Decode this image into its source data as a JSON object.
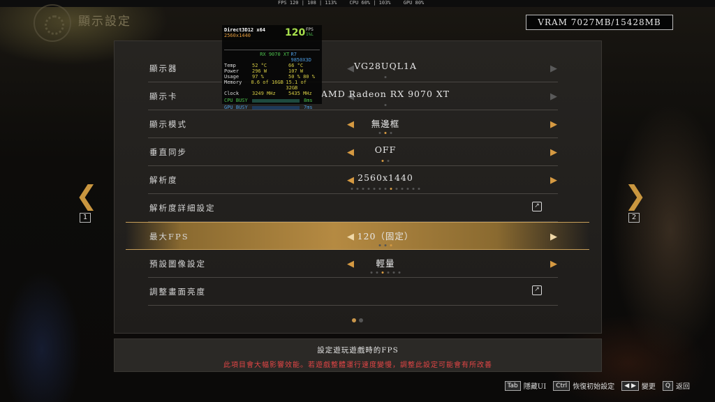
{
  "topbar": {
    "fps": "FPS 120 | 108 | 113%",
    "cpu": "CPU 60% | 103%",
    "gpu": "GPU 80%"
  },
  "page_title": "顯示設定",
  "vram": "VRAM 7027MB/15428MB",
  "osd": {
    "api": "Direct3D12 x64",
    "resolution": "2560x1440",
    "fps": "120",
    "fps_label": "FPS",
    "fps_sub": "1%L",
    "gpu_name": "RX 9070 XT",
    "cpu_name": "R7 9850X3D",
    "rows": [
      {
        "label": "Temp",
        "gpu": "52 °C",
        "cpu": "66 °C"
      },
      {
        "label": "Power",
        "gpu": "296 W",
        "cpu": "107 W"
      },
      {
        "label": "Usage",
        "gpu": "97 %",
        "cpu": "50 % 80 %"
      },
      {
        "label": "Memory",
        "gpu": "8.6 of 16GB",
        "cpu": "15.1 of 32GB"
      },
      {
        "label": "Clock",
        "gpu": "3249 MHz",
        "cpu": "5435 MHz"
      }
    ],
    "cpu_busy": {
      "label": "CPU BUSY",
      "value": "8ms",
      "level": 0.15
    },
    "gpu_busy": {
      "label": "GPU BUSY",
      "value": "7ms",
      "level": 0.9
    }
  },
  "settings": [
    {
      "label": "顯示器",
      "value": "VG28UQL1A",
      "active": false,
      "dots": 1,
      "sel": 0,
      "type": "select"
    },
    {
      "label": "顯示卡",
      "value": "AMD Radeon RX 9070 XT",
      "active": false,
      "dots": 1,
      "sel": 0,
      "type": "select"
    },
    {
      "label": "顯示模式",
      "value": "無邊框",
      "active": true,
      "dots": 3,
      "sel": 1,
      "type": "select"
    },
    {
      "label": "垂直同步",
      "value": "OFF",
      "active": true,
      "dots": 2,
      "sel": 0,
      "type": "select"
    },
    {
      "label": "解析度",
      "value": "2560x1440",
      "active": true,
      "dots": 13,
      "sel": 7,
      "type": "select"
    },
    {
      "label": "解析度詳細設定",
      "value": "",
      "type": "link"
    },
    {
      "label": "最大FPS",
      "value": "120（固定）",
      "active": true,
      "dots": 3,
      "sel": 2,
      "type": "select",
      "highlighted": true
    },
    {
      "label": "預設圖像設定",
      "value": "輕量",
      "active": true,
      "dots": 6,
      "sel": 2,
      "type": "select"
    },
    {
      "label": "調整畫面亮度",
      "value": "",
      "type": "link"
    }
  ],
  "nav": {
    "left_num": "1",
    "right_num": "2"
  },
  "pager": {
    "count": 2,
    "current": 0
  },
  "description": {
    "main": "設定遊玩遊戲時的FPS",
    "warning": "此項目會大幅影響效能。若遊戲整體運行速度變慢，調整此設定可能會有所改善"
  },
  "hints": [
    {
      "key": "Tab",
      "label": "隱藏UI"
    },
    {
      "key": "Ctrl",
      "label": "恢復初始設定"
    },
    {
      "key": "◀ ▶",
      "label": "變更"
    },
    {
      "key": "Q",
      "label": "返回"
    }
  ],
  "colors": {
    "accent": "#d69a42",
    "warning": "#e04545"
  }
}
